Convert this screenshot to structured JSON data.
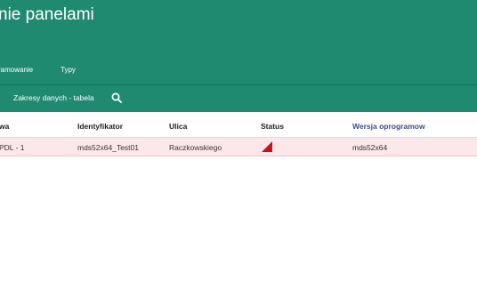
{
  "header": {
    "title": "nie panelami",
    "nav": [
      "ramowanie",
      "Typy"
    ]
  },
  "subbar": {
    "label": "Zakresy danych - tabela",
    "search_icon": "search-icon"
  },
  "table": {
    "columns": [
      "wa",
      "Identyfikator",
      "Ulica",
      "Status",
      "Wersja oprogramow"
    ],
    "rows": [
      {
        "name": "PDL - 1",
        "id": "mds52x64_Test01",
        "street": "Raczkowskiego",
        "status_icon": "red-triangle-flag-icon",
        "version": "mds52x64"
      }
    ]
  },
  "colors": {
    "header_bg": "#1f8a70",
    "row_highlight": "#fce8ea",
    "status_flag": "#cc1122",
    "link_header": "#3a4c8a"
  }
}
